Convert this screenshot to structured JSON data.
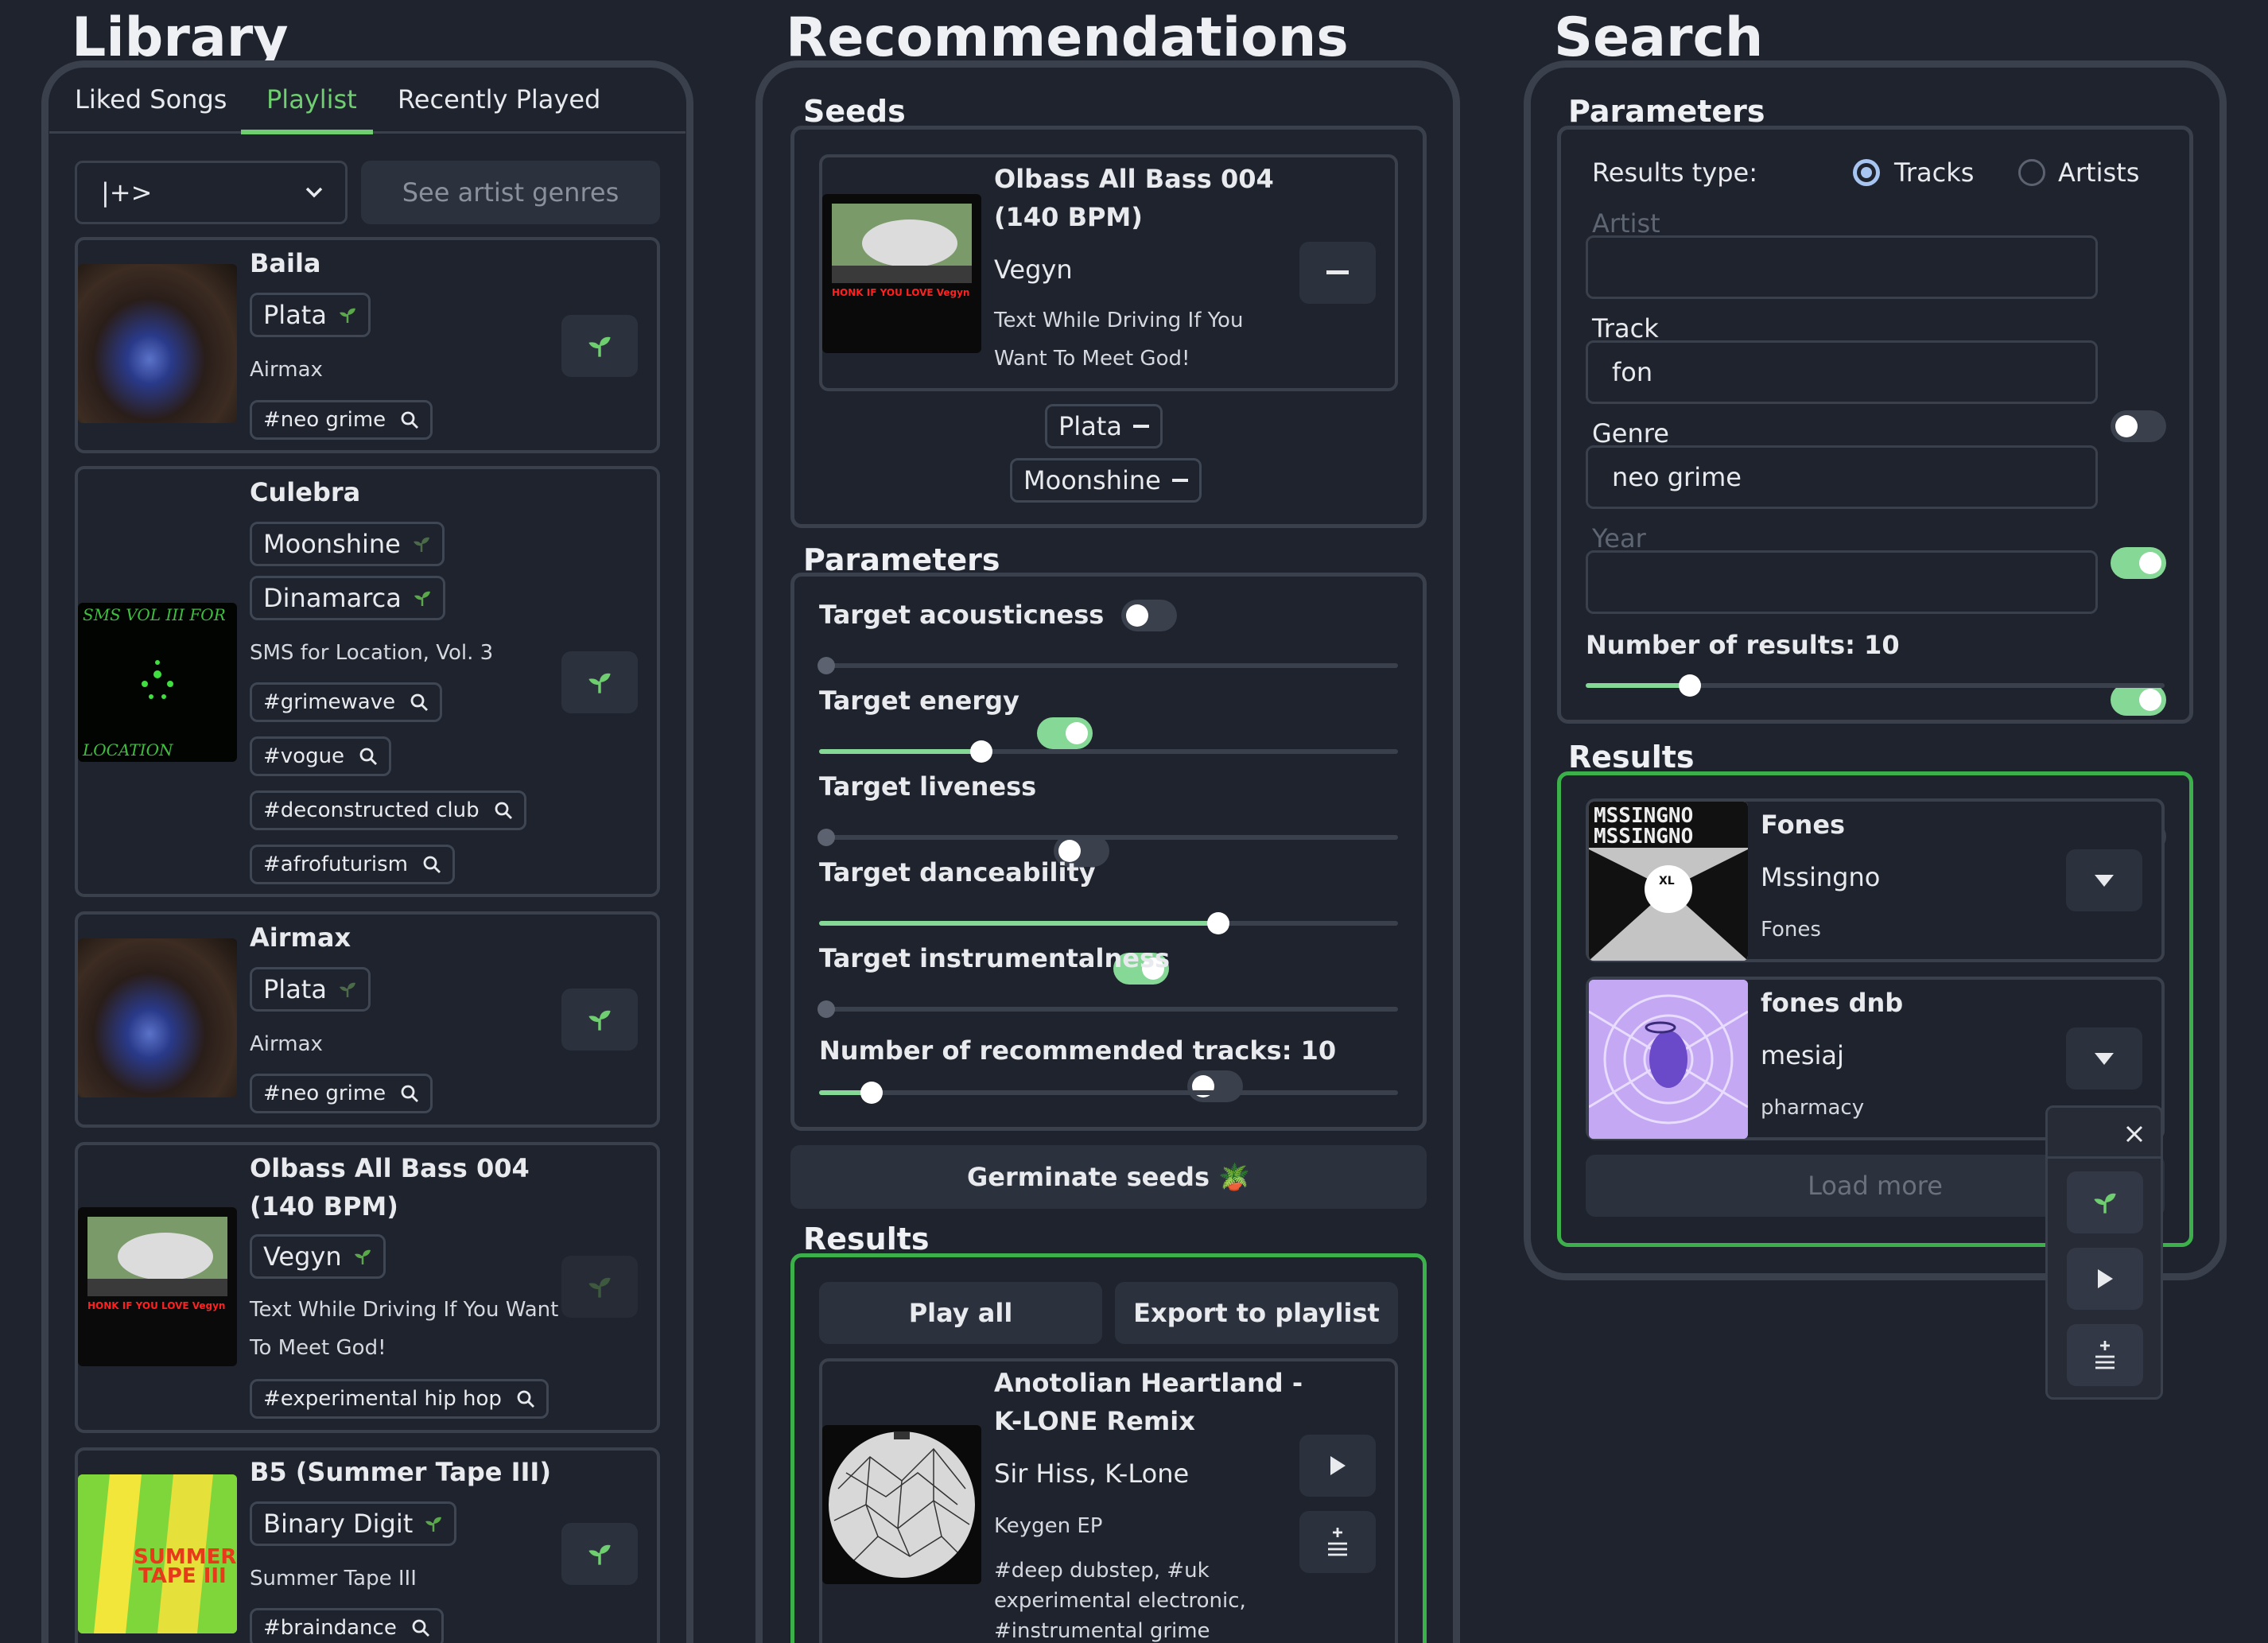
{
  "library": {
    "title": "Library",
    "tabs": [
      "Liked Songs",
      "Playlist",
      "Recently Played"
    ],
    "playlist_select": "|+>",
    "see_genres": "See artist genres",
    "items": [
      {
        "title": "Baila",
        "artists": [
          "Plata"
        ],
        "album": "Airmax",
        "tags": [
          "#neo grime"
        ]
      },
      {
        "title": "Culebra",
        "artists": [
          "Moonshine",
          "Dinamarca"
        ],
        "album": "SMS for Location, Vol. 3",
        "tags": [
          "#grimewave",
          "#vogue",
          "#deconstructed club",
          "#afrofuturism"
        ]
      },
      {
        "title": "Airmax",
        "artists": [
          "Plata"
        ],
        "album": "Airmax",
        "tags": [
          "#neo grime"
        ]
      },
      {
        "title_line1": "Olbass All Bass 004",
        "title_line2": "(140 BPM)",
        "artists": [
          "Vegyn"
        ],
        "album_line1": "Text While Driving If You Want",
        "album_line2": "To Meet God!",
        "tags": [
          "#experimental hip hop"
        ]
      },
      {
        "title": "B5 (Summer Tape III)",
        "artists": [
          "Binary Digit"
        ],
        "album": "Summer Tape III",
        "tags": [
          "#braindance"
        ]
      }
    ]
  },
  "recommendations": {
    "title": "Recommendations",
    "seeds_title": "Seeds",
    "seed_track": {
      "title_line1": "Olbass All Bass 004",
      "title_line2": "(140 BPM)",
      "artist": "Vegyn",
      "album_line1": "Text While Driving If You",
      "album_line2": "Want To Meet God!"
    },
    "seed_artists": [
      "Plata",
      "Moonshine"
    ],
    "params_title": "Parameters",
    "params": [
      {
        "label": "Target acousticness",
        "enabled": false,
        "value": 0
      },
      {
        "label": "Target energy",
        "enabled": true,
        "value": 0.28
      },
      {
        "label": "Target liveness",
        "enabled": false,
        "value": 0
      },
      {
        "label": "Target danceability",
        "enabled": true,
        "value": 0.69
      },
      {
        "label": "Target instrumentalness",
        "enabled": false,
        "value": 0
      }
    ],
    "num_tracks_label": "Number of recommended tracks: 10",
    "num_tracks_value": 0.09,
    "germinate": "Germinate seeds 🪴",
    "results_title": "Results",
    "play_all": "Play all",
    "export": "Export to playlist",
    "result_track": {
      "title_line1": "Anotolian Heartland -",
      "title_line2": "K-LONE Remix",
      "artists": "Sir Hiss, K-Lone",
      "album": "Keygen EP",
      "tags_line1": "#deep dubstep, #uk",
      "tags_line2": "experimental electronic,",
      "tags_line3": "#instrumental grime"
    }
  },
  "search": {
    "title": "Search",
    "params_title": "Parameters",
    "results_type_label": "Results type:",
    "type_options": [
      "Tracks",
      "Artists"
    ],
    "selected_type": "Tracks",
    "fields": [
      {
        "label": "Artist",
        "value": "",
        "enabled": false
      },
      {
        "label": "Track",
        "value": "fon",
        "enabled": true
      },
      {
        "label": "Genre",
        "value": "neo grime",
        "enabled": true
      },
      {
        "label": "Year",
        "value": "",
        "enabled": false
      }
    ],
    "num_results_label": "Number of results: 10",
    "num_results_value": 0.18,
    "results_title": "Results",
    "results": [
      {
        "title": "Fones",
        "artist": "Mssingno",
        "album": "Fones"
      },
      {
        "title": "fones dnb",
        "artist": "mesiaj",
        "album": "pharmacy"
      }
    ],
    "load_more": "Load more"
  },
  "colors": {
    "accent": "#6fcf70",
    "background": "#1e232d",
    "border": "#3a404c",
    "button": "#2c323d",
    "toggle_on": "#86d896"
  },
  "icons": [
    "sprout-icon",
    "search-icon",
    "chevron-down-icon",
    "minus-icon",
    "play-icon",
    "add-to-queue-icon",
    "close-icon",
    "caret-down-icon"
  ]
}
